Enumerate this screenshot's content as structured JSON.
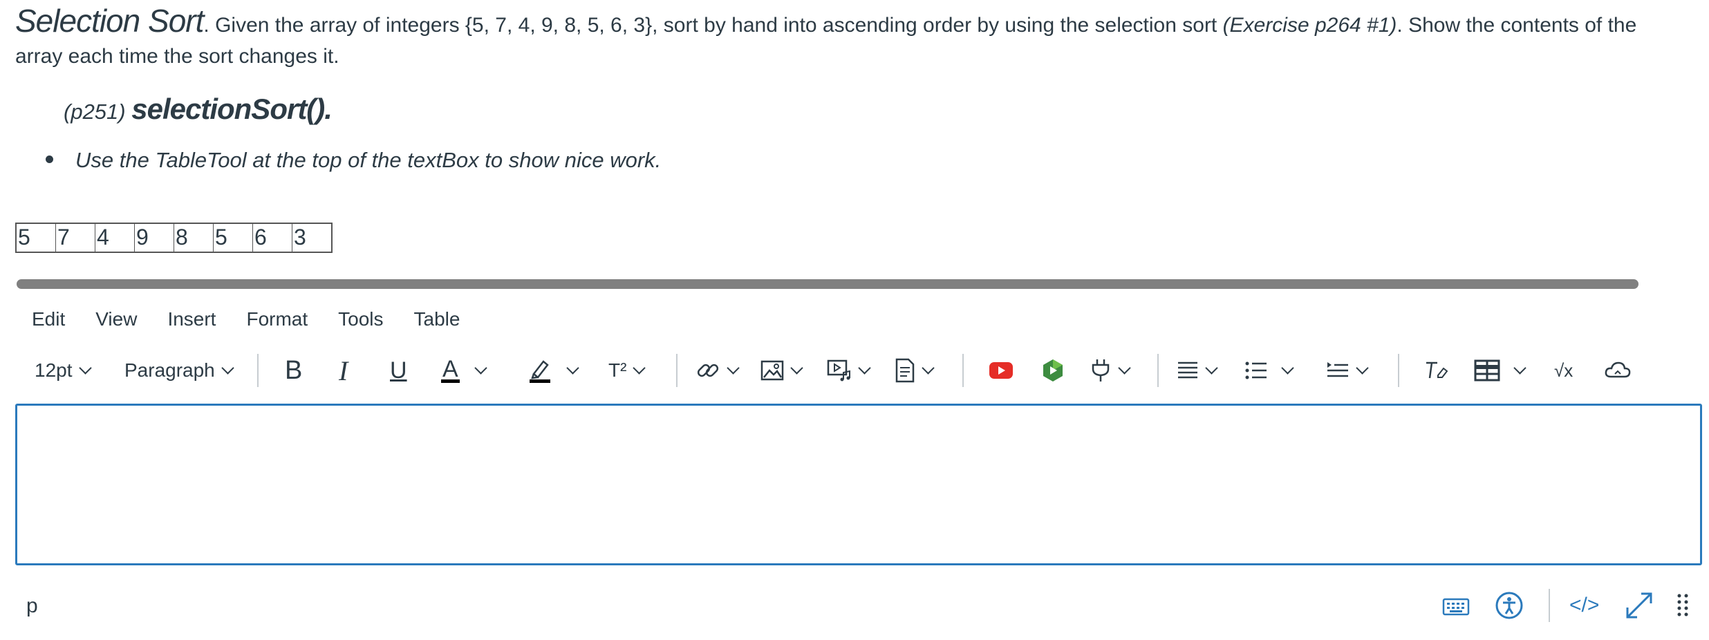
{
  "question": {
    "title": "Selection Sort",
    "period": ".",
    "text_a": " Given the array of integers {5, 7, 4, 9, 8, 5, 6, 3}, sort by hand into ascending order by using the selection sort ",
    "text_italic": "(Exercise p264 #1)",
    "text_b": ".  Show the contents of the",
    "text_line2": "array each time the sort changes it.",
    "ref_small": "(p251) ",
    "ref_big": "selectionSort().",
    "bullet": "Use the TableTool at the top of the textBox to show nice work."
  },
  "array_table": [
    "5",
    "7",
    "4",
    "9",
    "8",
    "5",
    "6",
    "3"
  ],
  "menu": {
    "edit": "Edit",
    "view": "View",
    "insert": "Insert",
    "format": "Format",
    "tools": "Tools",
    "table": "Table"
  },
  "toolbar": {
    "font_size": "12pt",
    "block_format": "Paragraph",
    "bold": "B",
    "italic": "I",
    "underline": "U",
    "font_color": "A",
    "superscript": "T²",
    "sqrt": "√x"
  },
  "status": {
    "element_path": "p",
    "html_toggle": "</>"
  },
  "colors": {
    "accent": "#2b7abc",
    "text": "#2d3b45",
    "youtube": "#e52d27",
    "scrollbar": "#808080"
  },
  "icons": [
    "link-icon",
    "image-icon",
    "media-icon",
    "document-icon",
    "youtube-icon",
    "app-icon",
    "plug-icon",
    "align-icon",
    "list-icon",
    "indent-icon",
    "clear-format-icon",
    "table-icon",
    "cloud-icon",
    "keyboard-icon",
    "accessibility-icon",
    "fullscreen-icon",
    "resize-handle-icon"
  ]
}
